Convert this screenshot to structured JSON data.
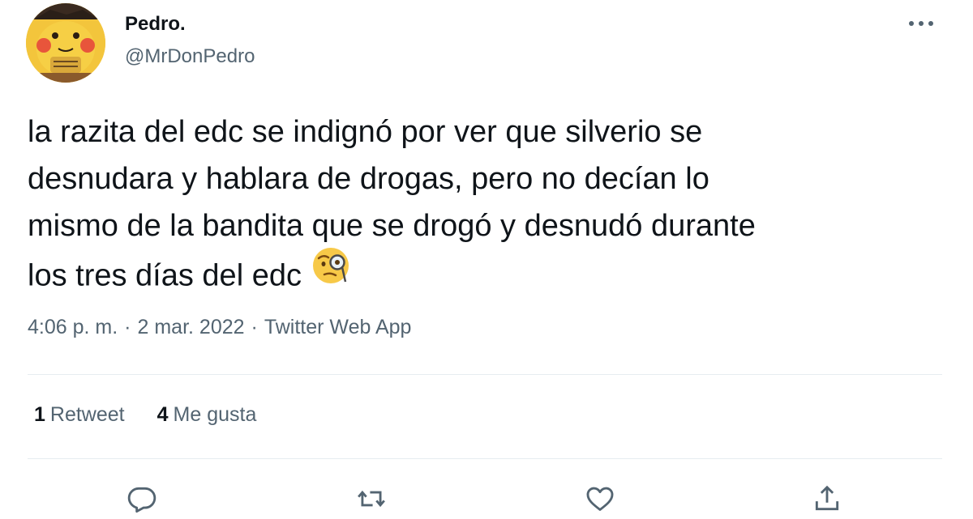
{
  "author": {
    "name": "Pedro.",
    "handle": "@MrDonPedro",
    "avatar_icon": "pikachu-avatar"
  },
  "more_icon": "more-dots-icon",
  "tweet": {
    "text": "la razita del edc se indignó por ver que silverio se\ndesnudara y hablara de drogas, pero no decían lo\nmismo de la bandita que se drogó y desnudó durante\nlos tres días del edc",
    "emoji": "face-with-monocle"
  },
  "meta": {
    "time": "4:06 p. m.",
    "separator": "·",
    "date": "2 mar. 2022",
    "source": "Twitter Web App"
  },
  "stats": {
    "retweets_count": "1",
    "retweets_label": "Retweet",
    "likes_count": "4",
    "likes_label": "Me gusta"
  },
  "actions": {
    "reply_icon": "reply-icon",
    "retweet_icon": "retweet-icon",
    "like_icon": "heart-icon",
    "share_icon": "share-icon"
  },
  "colors": {
    "text_primary": "#0f1419",
    "text_secondary": "#536471",
    "divider": "#e6ecf0"
  }
}
